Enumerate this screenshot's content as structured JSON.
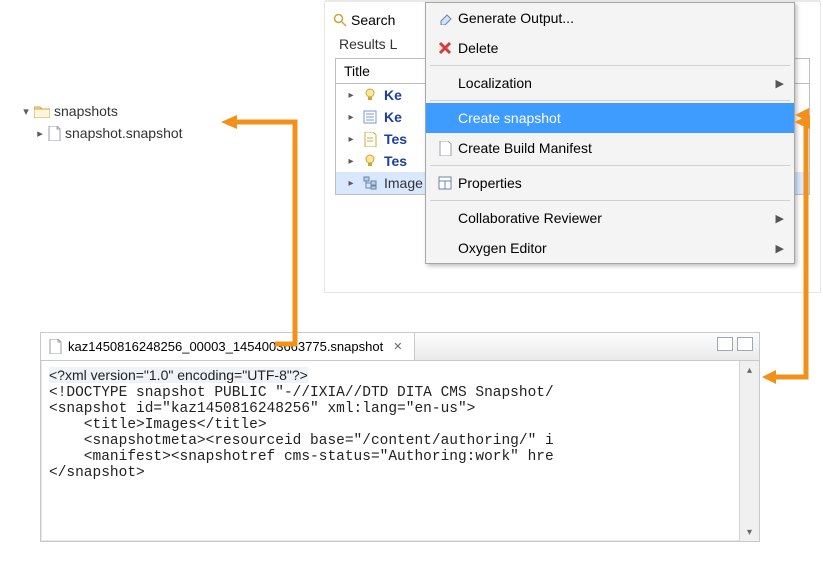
{
  "tree": {
    "folder": "snapshots",
    "file": "snapshot.snapshot"
  },
  "search_panel": {
    "tab_label": "Search",
    "results_label": "Results L",
    "header": "Title",
    "rows": [
      {
        "icon": "lightbulb",
        "label": "Ke"
      },
      {
        "icon": "list",
        "label": "Ke"
      },
      {
        "icon": "doc",
        "label": "Tes"
      },
      {
        "icon": "lightbulb",
        "label": "Tes"
      },
      {
        "icon": "tree",
        "label": "Image"
      }
    ]
  },
  "context_menu": {
    "items": [
      {
        "icon": "eraser",
        "label": "Generate Output..."
      },
      {
        "icon": "delete",
        "label": "Delete"
      },
      {
        "sep": true
      },
      {
        "icon": "",
        "label": "Localization",
        "submenu": true
      },
      {
        "sep": true
      },
      {
        "icon": "",
        "label": "Create snapshot",
        "highlight": true
      },
      {
        "icon": "page",
        "label": "Create Build Manifest"
      },
      {
        "sep": true
      },
      {
        "icon": "props",
        "label": "Properties"
      },
      {
        "sep": true
      },
      {
        "icon": "",
        "label": "Collaborative Reviewer",
        "submenu": true
      },
      {
        "icon": "",
        "label": "Oxygen Editor",
        "submenu": true
      }
    ]
  },
  "editor": {
    "tab_title": "kaz1450816248256_00003_1454003663775.snapshot",
    "code_lines": [
      "<?xml version=\"1.0\" encoding=\"UTF-8\"?>",
      "<!DOCTYPE snapshot PUBLIC \"-//IXIA//DTD DITA CMS Snapshot/",
      "<snapshot id=\"kaz1450816248256\" xml:lang=\"en-us\">",
      "    <title>Images</title>",
      "    <snapshotmeta><resourceid base=\"/content/authoring/\" i",
      "    <manifest><snapshotref cms-status=\"Authoring:work\" hre",
      "</snapshot>"
    ]
  },
  "arrow_color": "#F39019"
}
